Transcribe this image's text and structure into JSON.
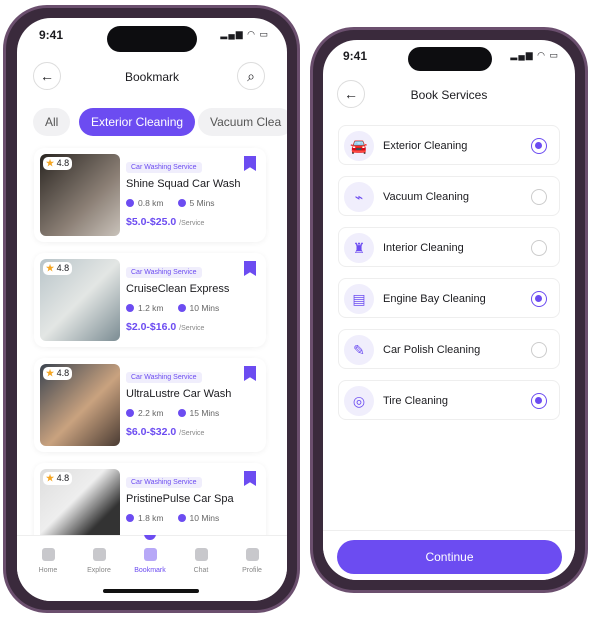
{
  "left_phone": {
    "status_time": "9:41",
    "title": "Bookmark",
    "filters": [
      {
        "label": "All",
        "active": false
      },
      {
        "label": "Exterior Cleaning",
        "active": true
      },
      {
        "label": "Vacuum Clea",
        "active": false
      }
    ],
    "cards": [
      {
        "rating": "4.8",
        "tag": "Car Washing Service",
        "name": "Shine Squad Car Wash",
        "distance": "0.8 km",
        "time": "5 Mins",
        "price": "$5.0-$25.0",
        "unit": "/Service"
      },
      {
        "rating": "4.8",
        "tag": "Car Washing Service",
        "name": "CruiseClean Express",
        "distance": "1.2 km",
        "time": "10 Mins",
        "price": "$2.0-$16.0",
        "unit": "/Service"
      },
      {
        "rating": "4.8",
        "tag": "Car Washing Service",
        "name": "UltraLustre Car Wash",
        "distance": "2.2 km",
        "time": "15 Mins",
        "price": "$6.0-$32.0",
        "unit": "/Service"
      },
      {
        "rating": "4.8",
        "tag": "Car Washing Service",
        "name": "PristinePulse Car Spa",
        "distance": "1.8 km",
        "time": "10 Mins",
        "price": "",
        "unit": ""
      }
    ],
    "nav": [
      {
        "label": "Home",
        "active": false
      },
      {
        "label": "Explore",
        "active": false
      },
      {
        "label": "Bookmark",
        "active": true
      },
      {
        "label": "Chat",
        "active": false
      },
      {
        "label": "Profile",
        "active": false
      }
    ]
  },
  "right_phone": {
    "status_time": "9:41",
    "title": "Book Services",
    "services": [
      {
        "label": "Exterior Cleaning",
        "icon": "car-wash-icon",
        "selected": true
      },
      {
        "label": "Vacuum Cleaning",
        "icon": "vacuum-icon",
        "selected": false
      },
      {
        "label": "Interior Cleaning",
        "icon": "car-seat-icon",
        "selected": false
      },
      {
        "label": "Engine Bay Cleaning",
        "icon": "engine-icon",
        "selected": true
      },
      {
        "label": "Car Polish Cleaning",
        "icon": "polish-icon",
        "selected": false
      },
      {
        "label": "Tire Cleaning",
        "icon": "tire-icon",
        "selected": true
      }
    ],
    "continue_label": "Continue"
  },
  "colors": {
    "accent": "#6c4cf1",
    "frame": "#6b4f6e"
  }
}
